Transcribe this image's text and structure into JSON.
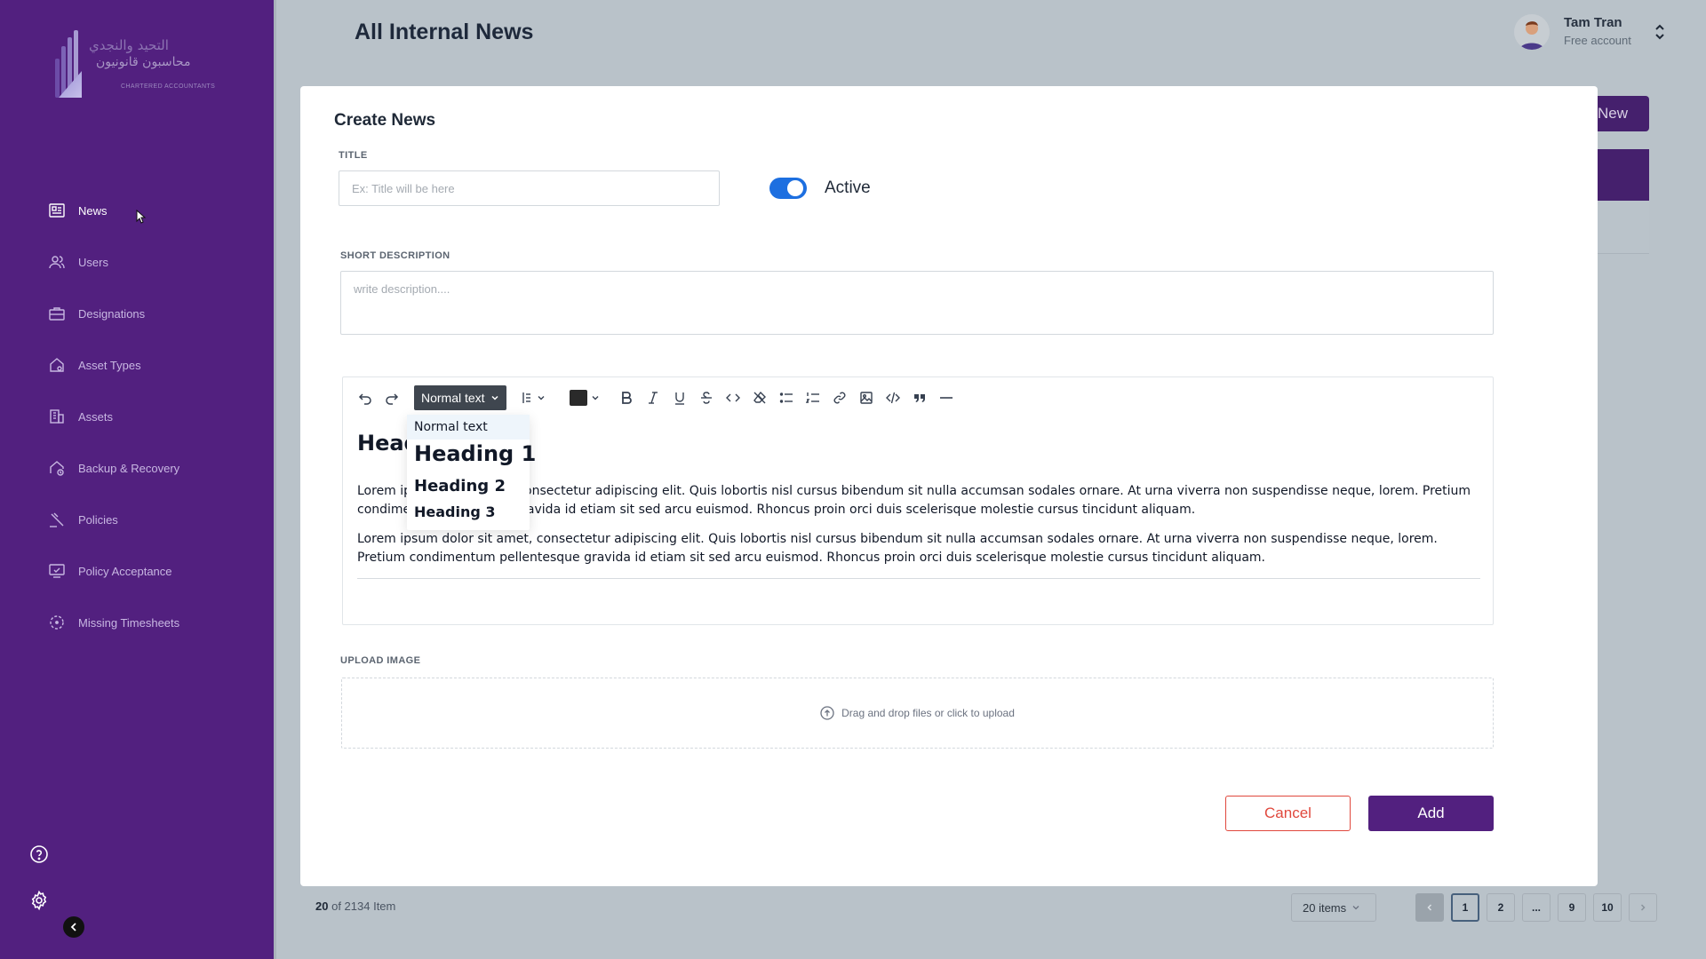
{
  "app": {
    "page_title": "All Internal News",
    "brand_color": "#52207f",
    "logo": {
      "arabic_line1": "التحيد والنجدي",
      "arabic_line2": "محاسبون قانونيون",
      "latin": "CHARTERED ACCOUNTANTS"
    }
  },
  "user": {
    "name": "Tam Tran",
    "subtitle": "Free account"
  },
  "sidebar": {
    "items": [
      {
        "label": "News",
        "icon": "newspaper-icon",
        "active": true
      },
      {
        "label": "Users",
        "icon": "users-icon"
      },
      {
        "label": "Designations",
        "icon": "briefcase-icon"
      },
      {
        "label": "Asset Types",
        "icon": "home-asset-icon"
      },
      {
        "label": "Assets",
        "icon": "building-icon"
      },
      {
        "label": "Backup & Recovery",
        "icon": "backup-icon"
      },
      {
        "label": "Policies",
        "icon": "gavel-icon"
      },
      {
        "label": "Policy Acceptance",
        "icon": "monitor-check-icon"
      },
      {
        "label": "Missing Timesheets",
        "icon": "clock-dashed-icon"
      }
    ]
  },
  "background": {
    "new_button_partial": "New"
  },
  "footer": {
    "count_shown": "20",
    "count_rest": "of 2134 Item",
    "items_per_page": "20 items",
    "pages": [
      "1",
      "2",
      "...",
      "9",
      "10"
    ],
    "current_page": "1"
  },
  "modal": {
    "title": "Create News",
    "title_label": "TITLE",
    "title_placeholder": "Ex: Title will be here",
    "active_label": "Active",
    "active_on": true,
    "desc_label": "SHORT DESCRIPTION",
    "desc_placeholder": "write description....",
    "editor": {
      "block_type": "Normal text",
      "heading_visible": "Head",
      "para1_left": "Lorem ip",
      "para1_right1": "onsectetur adipiscing elit. Quis lobortis nisl cursus bibendum sit nulla accumsan sodales ornare. At urna viverra non suspendisse neque, lorem. Pretium",
      "para1_left2": "condime",
      "para1_right2": "ravida id etiam sit sed arcu euismod. Rhoncus proin orci duis scelerisque molestie cursus tincidunt aliquam.",
      "para2": "Lorem ipsum dolor sit amet, consectetur adipiscing elit. Quis lobortis nisl cursus bibendum sit nulla accumsan sodales ornare. At urna viverra non suspendisse neque, lorem. Pretium condimentum pellentesque gravida id etiam sit sed arcu euismod. Rhoncus proin orci duis scelerisque molestie cursus tincidunt aliquam.",
      "dropdown_options": [
        "Normal text",
        "Heading 1",
        "Heading 2",
        "Heading 3"
      ],
      "selected_option": "Normal text",
      "text_color": "#2a2a2a"
    },
    "upload_label": "UPLOAD IMAGE",
    "upload_text": "Drag and drop files or click to upload",
    "cancel_label": "Cancel",
    "add_label": "Add"
  }
}
